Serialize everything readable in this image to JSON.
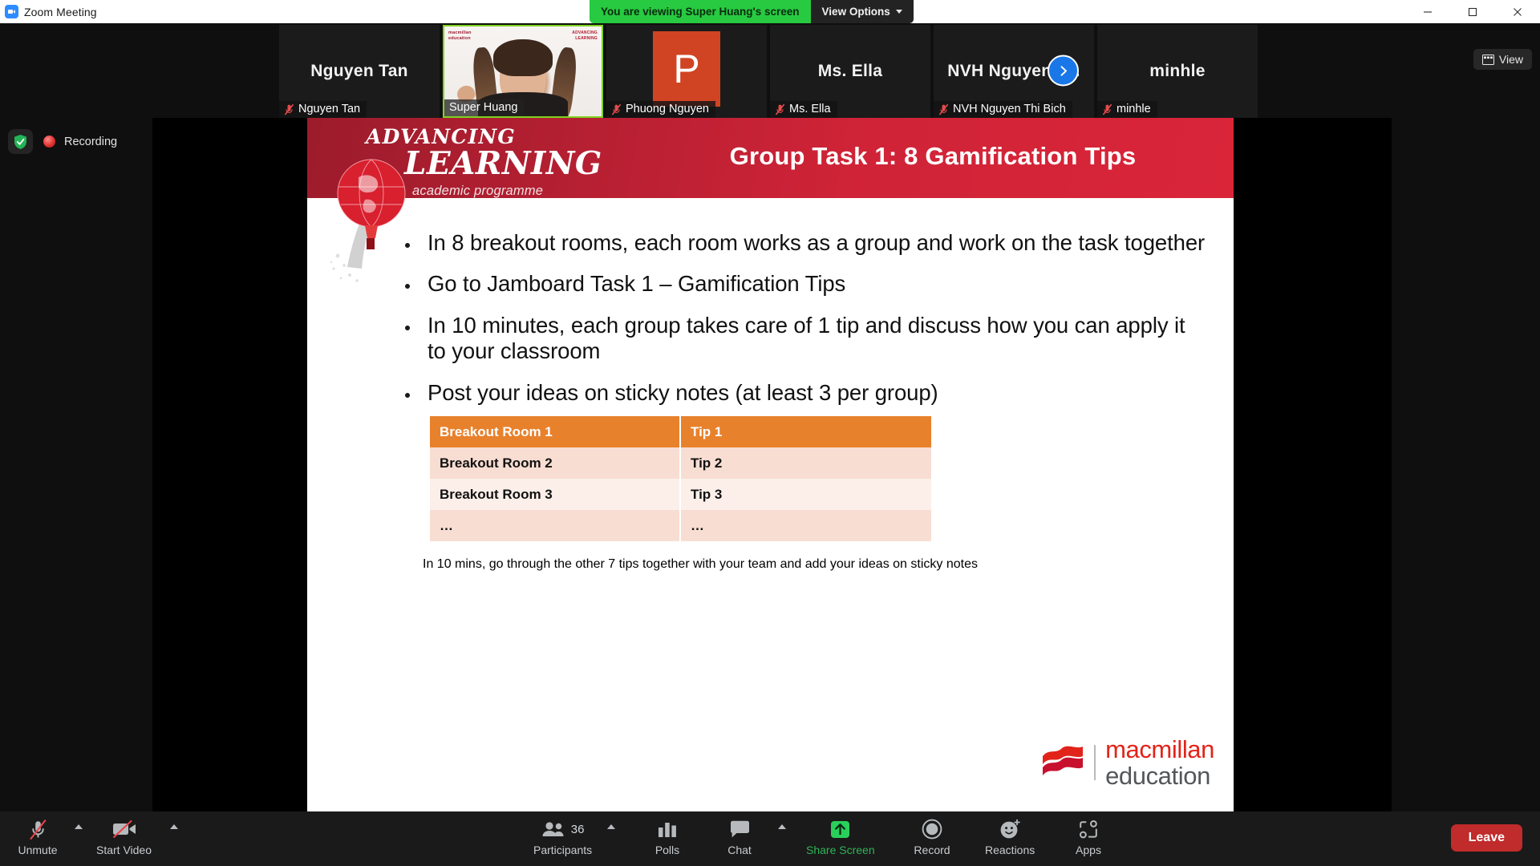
{
  "titlebar": {
    "app_title": "Zoom Meeting",
    "logo_icon": "zoom-logo-icon",
    "share_banner_text": "You are viewing Super Huang's screen",
    "view_options_label": "View Options",
    "minimize_icon": "minimize-icon",
    "maximize_icon": "maximize-icon",
    "close_icon": "close-icon"
  },
  "filmstrip": {
    "view_button_label": "View",
    "view_button_icon": "grid-view-icon",
    "next_arrow_icon": "chevron-right-icon",
    "participants": [
      {
        "display_name": "Nguyen Tan",
        "name_label": "Nguyen Tan",
        "muted": true,
        "kind": "initials",
        "active": false
      },
      {
        "display_name": "Super Huang",
        "name_label": "Super Huang",
        "muted": false,
        "kind": "video",
        "active": true
      },
      {
        "display_name": "P",
        "name_label": "Phuong Nguyen",
        "muted": true,
        "kind": "avatar",
        "active": false
      },
      {
        "display_name": "Ms. Ella",
        "name_label": "Ms. Ella",
        "muted": true,
        "kind": "initials",
        "active": false
      },
      {
        "display_name": "NVH Nguyen T...",
        "name_label": "NVH Nguyen Thi Bich",
        "muted": true,
        "kind": "initials",
        "active": false
      },
      {
        "display_name": "minhle",
        "name_label": "minhle",
        "muted": true,
        "kind": "initials",
        "active": false
      }
    ]
  },
  "recording": {
    "shield_icon": "encryption-shield-icon",
    "dot_icon": "recording-dot-icon",
    "label": "Recording"
  },
  "slide": {
    "brand_line1": "ADVANCING",
    "brand_line2": "LEARNING",
    "brand_line3": "academic programme",
    "balloon_icon": "hot-air-balloon-globe-icon",
    "title": "Group Task 1: 8 Gamification Tips",
    "header_color": "#cf2337",
    "bullets": [
      "In 8 breakout rooms, each room works as a group and work on the task together",
      "Go to Jamboard Task 1 – Gamification Tips",
      "In 10 minutes, each group takes care of 1 tip and discuss how you can apply it to your classroom",
      "Post your ideas on sticky notes (at least 3 per group)"
    ],
    "bullet_last": "In 10 mins, go through the other 7 tips together with your team and add your ideas on sticky notes",
    "table": {
      "header_color": "#e8812c",
      "rows": [
        {
          "room": "Breakout Room 1",
          "tip": "Tip 1"
        },
        {
          "room": "Breakout Room 2",
          "tip": "Tip 2"
        },
        {
          "room": "Breakout Room 3",
          "tip": "Tip 3"
        },
        {
          "room": "…",
          "tip": "…"
        }
      ]
    },
    "macmillan_logo": {
      "mark_icon": "macmillan-mark-icon",
      "line1": "macmillan",
      "line2": "education",
      "line1_color": "#e2231a",
      "line2_color": "#54575a"
    }
  },
  "toolbar": {
    "unmute": {
      "label": "Unmute",
      "icon": "microphone-muted-icon"
    },
    "start_video": {
      "label": "Start Video",
      "icon": "video-camera-off-icon"
    },
    "participants": {
      "label": "Participants",
      "icon": "participants-icon",
      "count": "36"
    },
    "polls": {
      "label": "Polls",
      "icon": "polls-bars-icon"
    },
    "chat": {
      "label": "Chat",
      "icon": "chat-bubble-icon"
    },
    "share_screen": {
      "label": "Share Screen",
      "icon": "share-screen-up-arrow-icon",
      "color": "#2fb457"
    },
    "record": {
      "label": "Record",
      "icon": "record-circle-icon"
    },
    "reactions": {
      "label": "Reactions",
      "icon": "reactions-smiley-icon"
    },
    "apps": {
      "label": "Apps",
      "icon": "apps-icon"
    },
    "leave": {
      "label": "Leave",
      "color": "#c02b2b"
    }
  }
}
